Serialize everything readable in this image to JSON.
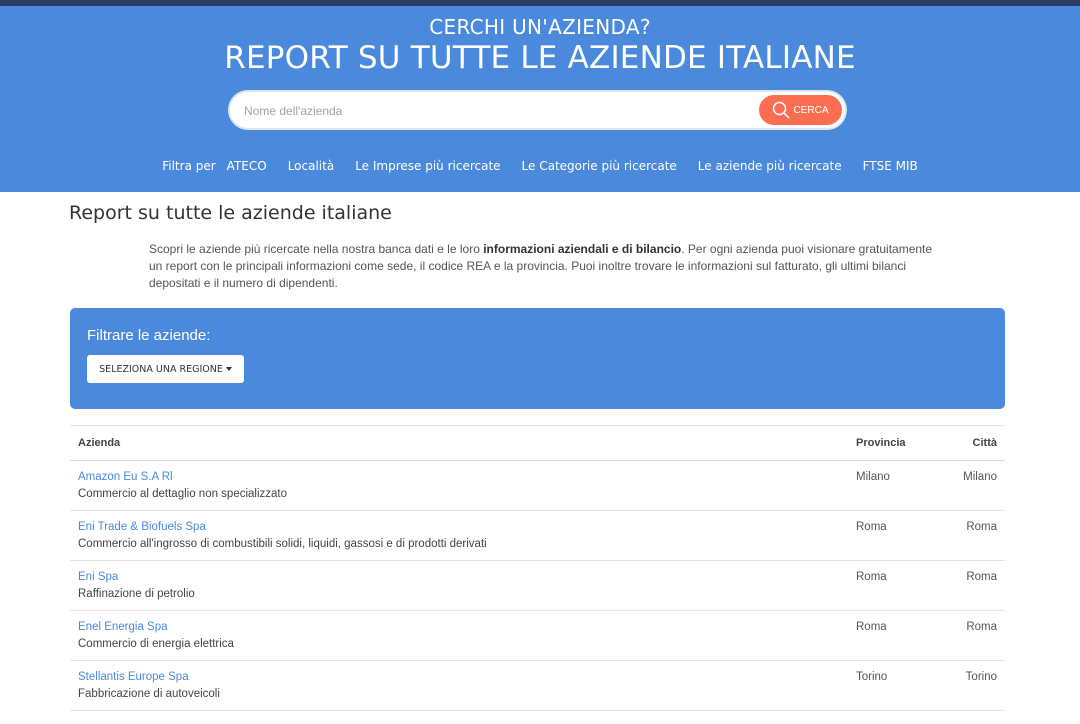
{
  "hero": {
    "subtitle": "CERCHI UN'AZIENDA?",
    "title": "REPORT SU TUTTE LE AZIENDE ITALIANE",
    "search_placeholder": "Nome dell'azienda",
    "search_button": "CERCA"
  },
  "nav": {
    "filter_label": "Filtra per",
    "items": [
      "ATECO",
      "Località",
      "Le Imprese più ricercate",
      "Le Categorie più ricercate",
      "Le aziende più ricercate",
      "FTSE MIB"
    ]
  },
  "page": {
    "title": "Report su tutte le aziende italiane",
    "intro_before": "Scopri le aziende più ricercate nella nostra banca dati e le loro ",
    "intro_bold": "informazioni aziendali e di bilancio",
    "intro_after": ". Per ogni azienda puoi visionare gratuitamente un report con le principali informazioni come sede, il codice REA e la provincia. Puoi inoltre trovare le informazioni sul fatturato, gli ultimi bilanci depositati e il numero di dipendenti."
  },
  "filter": {
    "title": "Filtrare le aziende:",
    "region_button": "SELEZIONA UNA REGIONE"
  },
  "table": {
    "headers": {
      "company": "Azienda",
      "province": "Provincia",
      "city": "Città"
    },
    "rows": [
      {
        "name": "Amazon Eu S.A Rl",
        "desc": "Commercio al dettaglio non specializzato",
        "province": "Milano",
        "city": "Milano"
      },
      {
        "name": "Eni Trade & Biofuels Spa",
        "desc": "Commercio all'ingrosso di combustibili solidi, liquidi, gassosi e di prodotti derivati",
        "province": "Roma",
        "city": "Roma"
      },
      {
        "name": "Eni Spa",
        "desc": "Raffinazione di petrolio",
        "province": "Roma",
        "city": "Roma"
      },
      {
        "name": "Enel Energia Spa",
        "desc": "Commercio di energia elettrica",
        "province": "Roma",
        "city": "Roma"
      },
      {
        "name": "Stellantis Europe Spa",
        "desc": "Fabbricazione di autoveicoli",
        "province": "Torino",
        "city": "Torino"
      }
    ]
  },
  "colors": {
    "brand_blue": "#4a89dc",
    "search_orange": "#fb6e52",
    "top_strip": "#2c3e63"
  }
}
